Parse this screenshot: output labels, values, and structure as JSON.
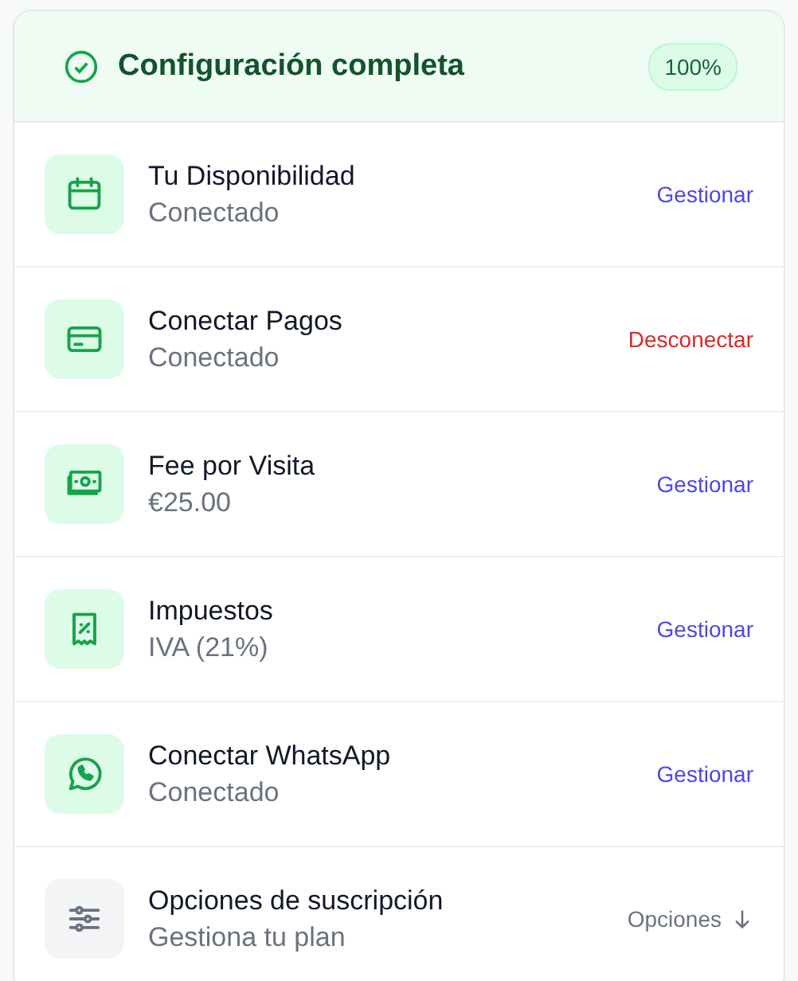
{
  "header": {
    "title": "Configuración completa",
    "badge": "100%"
  },
  "items": [
    {
      "kind": "service",
      "title": "Tu Disponibilidad",
      "subtitle": "Conectado",
      "action": {
        "label": "Gestionar",
        "kind": "manage"
      }
    },
    {
      "kind": "service",
      "title": "Conectar Pagos",
      "subtitle": "Conectado",
      "action": {
        "label": "Desconectar",
        "kind": "danger"
      }
    },
    {
      "kind": "service",
      "title": "Fee por Visita",
      "subtitle": "€25.00",
      "action": {
        "label": "Gestionar",
        "kind": "manage"
      }
    },
    {
      "kind": "service",
      "title": "Impuestos",
      "subtitle": "IVA (21%)",
      "action": {
        "label": "Gestionar",
        "kind": "manage"
      }
    },
    {
      "kind": "service",
      "title": "Conectar WhatsApp",
      "subtitle": "Conectado",
      "action": {
        "label": "Gestionar",
        "kind": "manage"
      }
    },
    {
      "kind": "options",
      "title": "Opciones de suscripción",
      "subtitle": "Gestiona tu plan",
      "action": {
        "label": "Opciones",
        "kind": "dropdown"
      }
    }
  ]
}
